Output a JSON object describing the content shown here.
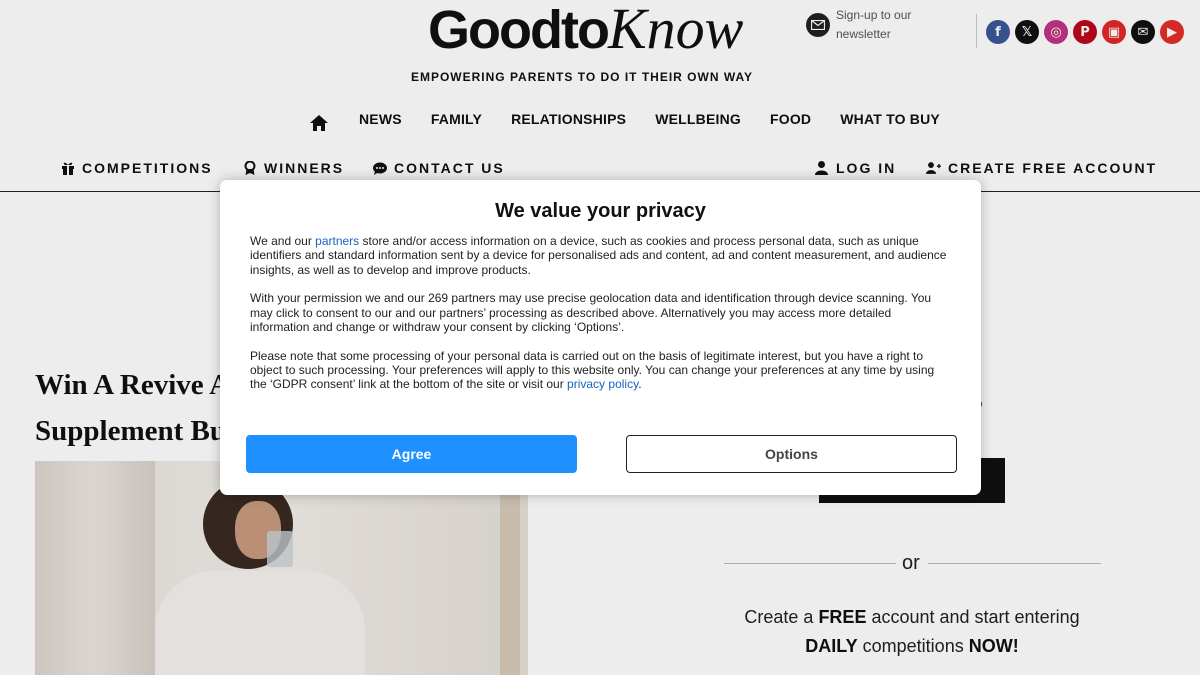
{
  "header": {
    "logo_main": "Goodto",
    "logo_italic": "Know",
    "newsletter": "Sign-up to our newsletter",
    "tagline": "EMPOWERING PARENTS TO DO IT THEIR OWN WAY",
    "socials": [
      {
        "name": "facebook-icon",
        "glyph": "f",
        "color": "#3b5998"
      },
      {
        "name": "x-twitter-icon",
        "glyph": "𝕏",
        "color": "#111111"
      },
      {
        "name": "instagram-icon",
        "glyph": "◎",
        "color": "#c13584"
      },
      {
        "name": "pinterest-icon",
        "glyph": "P",
        "color": "#bd081c"
      },
      {
        "name": "flipboard-icon",
        "glyph": "▣",
        "color": "#e12828"
      },
      {
        "name": "email-icon",
        "glyph": "✉",
        "color": "#111111"
      },
      {
        "name": "youtube-icon",
        "glyph": "▶",
        "color": "#e52d27"
      }
    ]
  },
  "nav": {
    "items": [
      "NEWS",
      "FAMILY",
      "RELATIONSHIPS",
      "WELLBEING",
      "FOOD",
      "WHAT TO BUY"
    ]
  },
  "subnav": {
    "competitions": "COMPETITIONS",
    "winners": "WINNERS",
    "contact": "CONTACT US",
    "login": "LOG IN",
    "create": "CREATE FREE ACCOUNT"
  },
  "article": {
    "title_line1": "Win A Revive A",
    "title_line2": "Supplement Bu"
  },
  "sidebar": {
    "title_fragment": "ers",
    "or": "or",
    "copy_pre": "Create a ",
    "copy_free": "FREE",
    "copy_mid": " account and start entering",
    "copy_daily": "DAILY",
    "copy_mid2": " competitions ",
    "copy_now": "NOW!"
  },
  "consent": {
    "title": "We value your privacy",
    "p1_pre": "We and our ",
    "p1_link": "partners",
    "p1_post": " store and/or access information on a device, such as cookies and process personal data, such as unique identifiers and standard information sent by a device for personalised ads and content, ad and content measurement, and audience insights, as well as to develop and improve products.",
    "p2": "With your permission we and our 269 partners may use precise geolocation data and identification through device scanning. You may click to consent to our and our partners’ processing as described above. Alternatively you may access more detailed information and change or withdraw your consent by clicking ‘Options’.",
    "p3_pre": "Please note that some processing of your personal data is carried out on the basis of legitimate interest, but you have a right to object to such processing. Your preferences will apply to this website only. You can change your preferences at any time by using the ‘GDPR consent’ link at the bottom of the site or visit our ",
    "p3_link": "privacy policy",
    "p3_post": ".",
    "agree": "Agree",
    "options": "Options"
  }
}
